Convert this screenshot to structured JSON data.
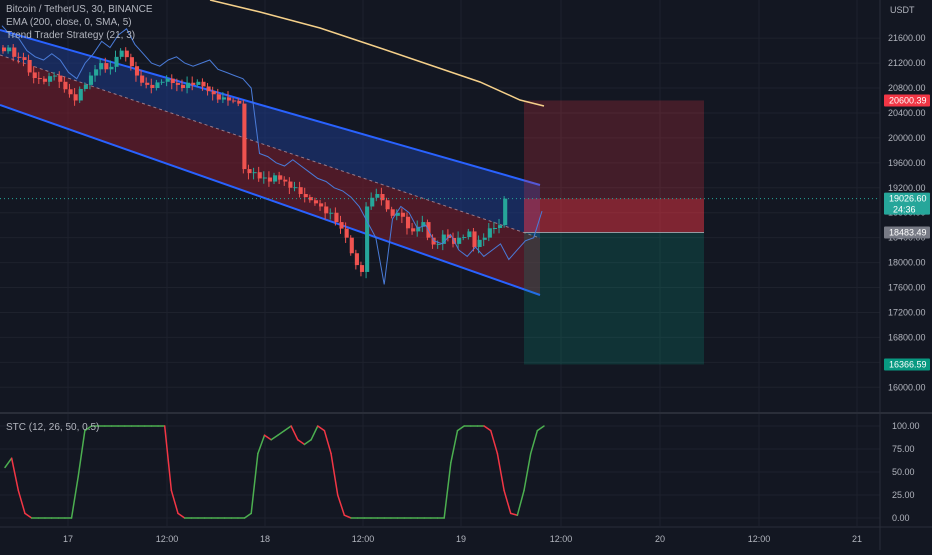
{
  "legend": {
    "symbol": "Bitcoin / TetherUS, 30, BINANCE",
    "ema": "EMA (200, close, 0, SMA, 5)",
    "strategy": "Trend Trader Strategy (21, 3)",
    "stc": "STC (12, 26, 50, 0.5)"
  },
  "currency": "USDT",
  "colors": {
    "background": "#131722",
    "grid": "#1e222d",
    "up": "#26a69a",
    "down": "#ef5350",
    "channel_line": "#2962ff",
    "channel_upper_fill": "#1e3a8a",
    "channel_lower_fill": "#7f1d2d",
    "ema": "#f5d08a",
    "stc_up": "#4caf50",
    "stc_down": "#f23645"
  },
  "price_axis": {
    "ticks": [
      "21600.00",
      "21200.00",
      "20800.00",
      "20400.00",
      "20000.00",
      "19600.00",
      "19200.00",
      "18800.00",
      "18400.00",
      "18000.00",
      "17600.00",
      "17200.00",
      "16800.00",
      "16400.00",
      "16000.00"
    ]
  },
  "price_labels": {
    "stop": "20600.39",
    "current": "19026.60",
    "countdown": "24:36",
    "entry": "18483.49",
    "target": "16366.59"
  },
  "stc_axis": {
    "ticks": [
      "100.00",
      "75.00",
      "50.00",
      "25.00",
      "0.00"
    ]
  },
  "time_axis": {
    "ticks": [
      "17",
      "12:00",
      "18",
      "12:00",
      "19",
      "12:00",
      "20",
      "12:00",
      "21"
    ]
  },
  "chart_data": [
    {
      "type": "line",
      "title": "Bitcoin / TetherUS, 30, BINANCE",
      "ylim": [
        15800,
        22000
      ],
      "x": [
        "17",
        "12:00",
        "18",
        "12:00",
        "19",
        "12:00"
      ],
      "series": [
        {
          "name": "EMA (200, close, 0, SMA, 5)",
          "values": [
            22300,
            21950,
            21550,
            21150,
            20850,
            20580
          ]
        }
      ],
      "price_walk": [
        21450,
        21300,
        21250,
        21050,
        20950,
        20900,
        21000,
        20900,
        20700,
        20600,
        20850,
        21000,
        21200,
        21100,
        21300,
        21400,
        21150,
        21000,
        20850,
        20800,
        20900,
        20950,
        20850,
        20800,
        20850,
        20900,
        20750,
        20700,
        20650,
        20600,
        20550,
        19500,
        19450,
        19350,
        19300,
        19400,
        19300,
        19200,
        19100,
        19050,
        18950,
        18900,
        18800,
        18650,
        18400,
        18150,
        17850,
        18900,
        19100,
        19000,
        18750,
        18800,
        18550,
        18500,
        18650,
        18400,
        18300,
        18450,
        18300,
        18400,
        18500,
        18250,
        18400,
        18550,
        18600,
        19026.6
      ],
      "trend_channel": {
        "upper": [
          [
            0,
            21950
          ],
          [
            540,
            19200
          ]
        ],
        "middle": [
          [
            0,
            21400
          ],
          [
            540,
            18450
          ]
        ],
        "lower": [
          [
            0,
            20800
          ],
          [
            540,
            17550
          ]
        ]
      },
      "long_short_position": {
        "stop": 20600.39,
        "entry": 18483.49,
        "target": 16366.59,
        "current": 19026.6
      }
    },
    {
      "type": "line",
      "title": "STC (12, 26, 50, 0.5)",
      "ylim": [
        0,
        100
      ],
      "ticks": [
        0,
        25,
        50,
        75,
        100
      ],
      "series": [
        {
          "name": "STC (12, 26, 50, 0.5)",
          "values": [
            55,
            65,
            30,
            5,
            0,
            0,
            0,
            0,
            0,
            0,
            0,
            45,
            95,
            100,
            100,
            100,
            100,
            100,
            100,
            100,
            100,
            100,
            100,
            100,
            100,
            30,
            5,
            0,
            0,
            0,
            0,
            0,
            0,
            0,
            0,
            0,
            0,
            5,
            70,
            90,
            85,
            90,
            95,
            100,
            85,
            80,
            85,
            100,
            95,
            70,
            25,
            3,
            0,
            0,
            0,
            0,
            0,
            0,
            0,
            0,
            0,
            0,
            0,
            0,
            0,
            0,
            0,
            60,
            95,
            100,
            100,
            100,
            100,
            95,
            70,
            30,
            5,
            3,
            30,
            70,
            95,
            100
          ]
        }
      ]
    }
  ]
}
